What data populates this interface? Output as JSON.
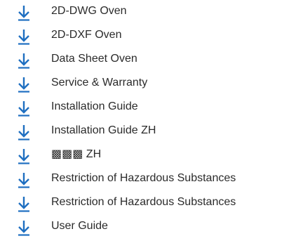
{
  "accent_color": "#1f6fc1",
  "icon": "download-arrow-icon",
  "downloads": [
    {
      "label": "2D-DWG Oven"
    },
    {
      "label": "2D-DXF Oven"
    },
    {
      "label": "Data Sheet Oven"
    },
    {
      "label": "Service & Warranty"
    },
    {
      "label": "Installation Guide"
    },
    {
      "label": "Installation Guide ZH"
    },
    {
      "label": "▩▩▩ ZH"
    },
    {
      "label": "Restriction of Hazardous Substances"
    },
    {
      "label": "Restriction of Hazardous Substances"
    },
    {
      "label": "User Guide"
    }
  ]
}
